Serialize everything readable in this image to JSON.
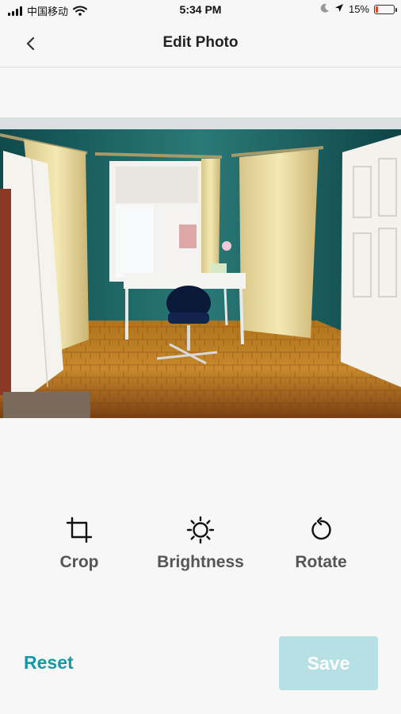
{
  "status_bar": {
    "carrier": "中国移动",
    "time": "5:34 PM",
    "battery": "15%",
    "battery_level": 0.15,
    "icons": [
      "signal-icon",
      "wifi-icon",
      "moon-icon",
      "location-arrow-icon",
      "battery-icon"
    ]
  },
  "nav": {
    "title": "Edit Photo",
    "back_icon": "chevron-left-icon"
  },
  "photo": {
    "description_icon": "room-photo"
  },
  "tools": [
    {
      "label": "Crop",
      "icon": "crop-icon"
    },
    {
      "label": "Brightness",
      "icon": "sun-icon"
    },
    {
      "label": "Rotate",
      "icon": "rotate-icon"
    }
  ],
  "footer": {
    "reset_label": "Reset",
    "save_label": "Save"
  },
  "colors": {
    "accent": "#1a97a6",
    "save_disabled_bg": "#b7e0e5",
    "battery_low": "#e0442a",
    "background": "#f7f7f7"
  }
}
